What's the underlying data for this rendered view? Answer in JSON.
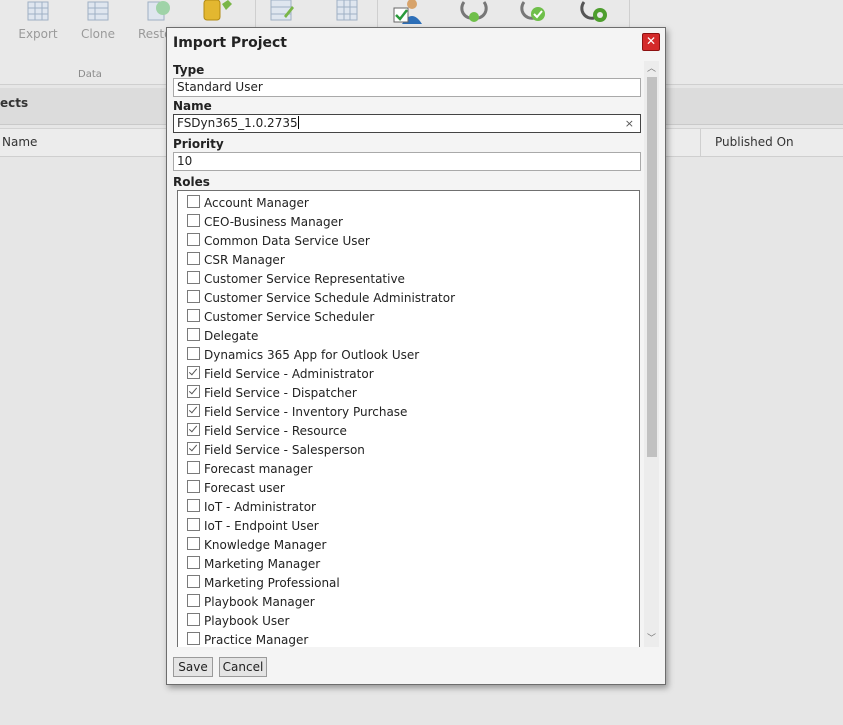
{
  "ribbon": {
    "buttons": [
      {
        "label": "Export",
        "icon": "export-grid-icon"
      },
      {
        "label": "Clone",
        "icon": "clone-grid-icon"
      },
      {
        "label": "Resto",
        "icon": "restore-icon"
      }
    ],
    "group_label": "Data"
  },
  "section": {
    "title": "ects"
  },
  "grid": {
    "columns": [
      "Name",
      "Published On"
    ]
  },
  "dialog": {
    "title": "Import Project",
    "close_glyph": "✕",
    "type_label": "Type",
    "type_value": "Standard User",
    "name_label": "Name",
    "name_value": "FSDyn365_1.0.2735",
    "clear_glyph": "×",
    "priority_label": "Priority",
    "priority_value": "10",
    "roles_label": "Roles",
    "roles": [
      {
        "label": "Account Manager",
        "checked": false
      },
      {
        "label": "CEO-Business Manager",
        "checked": false
      },
      {
        "label": "Common Data Service User",
        "checked": false
      },
      {
        "label": "CSR Manager",
        "checked": false
      },
      {
        "label": "Customer Service Representative",
        "checked": false
      },
      {
        "label": "Customer Service Schedule Administrator",
        "checked": false
      },
      {
        "label": "Customer Service Scheduler",
        "checked": false
      },
      {
        "label": "Delegate",
        "checked": false
      },
      {
        "label": "Dynamics 365 App for Outlook User",
        "checked": false
      },
      {
        "label": "Field Service - Administrator",
        "checked": true
      },
      {
        "label": "Field Service - Dispatcher",
        "checked": true
      },
      {
        "label": "Field Service - Inventory Purchase",
        "checked": true
      },
      {
        "label": "Field Service - Resource",
        "checked": true
      },
      {
        "label": "Field Service - Salesperson",
        "checked": true
      },
      {
        "label": "Forecast manager",
        "checked": false
      },
      {
        "label": "Forecast user",
        "checked": false
      },
      {
        "label": "IoT - Administrator",
        "checked": false
      },
      {
        "label": "IoT - Endpoint User",
        "checked": false
      },
      {
        "label": "Knowledge Manager",
        "checked": false
      },
      {
        "label": "Marketing Manager",
        "checked": false
      },
      {
        "label": "Marketing Professional",
        "checked": false
      },
      {
        "label": "Playbook Manager",
        "checked": false
      },
      {
        "label": "Playbook User",
        "checked": false
      },
      {
        "label": "Practice Manager",
        "checked": false
      }
    ],
    "save_label": "Save",
    "cancel_label": "Cancel"
  },
  "colors": {
    "close_button": "#d42a2a",
    "background": "#e6e6e6",
    "dialog": "#f4f4f4"
  }
}
